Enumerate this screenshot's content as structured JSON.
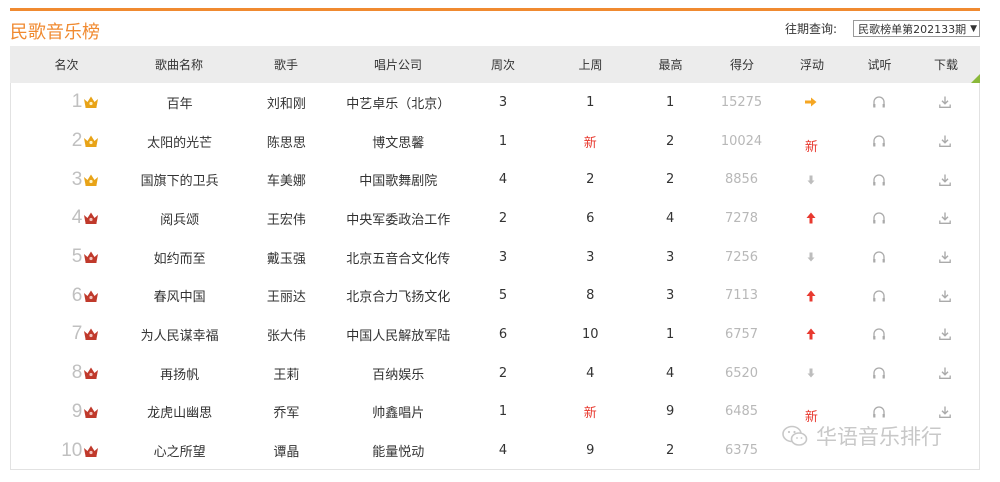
{
  "title": "民歌音乐榜",
  "period": {
    "label": "往期查询:",
    "selected": "民歌榜单第202133期"
  },
  "columns": [
    "名次",
    "歌曲名称",
    "歌手",
    "唱片公司",
    "周次",
    "上周",
    "最高",
    "得分",
    "浮动",
    "试听",
    "下载"
  ],
  "rows": [
    {
      "rank": "1",
      "crown": "gold",
      "song": "百年",
      "singer": "刘和刚",
      "company": "中艺卓乐（北京）",
      "weeks": "3",
      "last": "1",
      "peak": "1",
      "score": "15275",
      "float": "flat"
    },
    {
      "rank": "2",
      "crown": "gold",
      "song": "太阳的光芒",
      "singer": "陈思思",
      "company": "博文思馨",
      "weeks": "1",
      "last": "新",
      "peak": "2",
      "score": "10024",
      "float": "new"
    },
    {
      "rank": "3",
      "crown": "gold",
      "song": "国旗下的卫兵",
      "singer": "车美娜",
      "company": "中国歌舞剧院",
      "weeks": "4",
      "last": "2",
      "peak": "2",
      "score": "8856",
      "float": "down"
    },
    {
      "rank": "4",
      "crown": "red",
      "song": "阅兵颂",
      "singer": "王宏伟",
      "company": "中央军委政治工作",
      "weeks": "2",
      "last": "6",
      "peak": "4",
      "score": "7278",
      "float": "up"
    },
    {
      "rank": "5",
      "crown": "red",
      "song": "如约而至",
      "singer": "戴玉强",
      "company": "北京五音合文化传",
      "weeks": "3",
      "last": "3",
      "peak": "3",
      "score": "7256",
      "float": "down"
    },
    {
      "rank": "6",
      "crown": "red",
      "song": "春风中国",
      "singer": "王丽达",
      "company": "北京合力飞扬文化",
      "weeks": "5",
      "last": "8",
      "peak": "3",
      "score": "7113",
      "float": "up"
    },
    {
      "rank": "7",
      "crown": "red",
      "song": "为人民谋幸福",
      "singer": "张大伟",
      "company": "中国人民解放军陆",
      "weeks": "6",
      "last": "10",
      "peak": "1",
      "score": "6757",
      "float": "up"
    },
    {
      "rank": "8",
      "crown": "red",
      "song": "再扬帆",
      "singer": "王莉",
      "company": "百纳娱乐",
      "weeks": "2",
      "last": "4",
      "peak": "4",
      "score": "6520",
      "float": "down"
    },
    {
      "rank": "9",
      "crown": "red",
      "song": "龙虎山幽思",
      "singer": "乔军",
      "company": "帅鑫唱片",
      "weeks": "1",
      "last": "新",
      "peak": "9",
      "score": "6485",
      "float": "new"
    },
    {
      "rank": "10",
      "crown": "red",
      "song": "心之所望",
      "singer": "谭晶",
      "company": "能量悦动",
      "weeks": "4",
      "last": "9",
      "peak": "2",
      "score": "6375",
      "float": "none"
    }
  ],
  "new_label": "新",
  "watermark": "华语音乐排行",
  "colors": {
    "accent": "#f08a30",
    "new": "#e8392f",
    "up": "#e8392f",
    "flat": "#f5a623",
    "down": "#bdbdbd",
    "crown_gold": "#e8a317",
    "crown_red": "#c0392b"
  }
}
